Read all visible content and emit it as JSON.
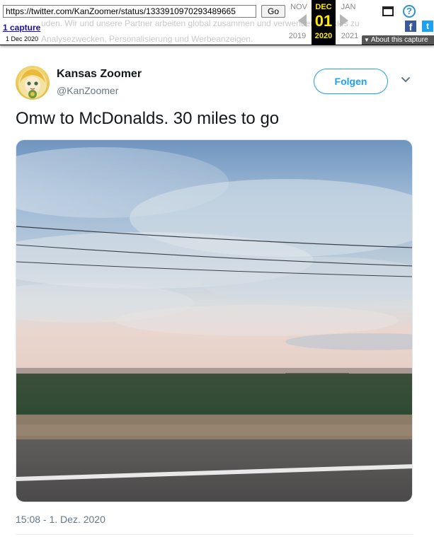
{
  "wayback": {
    "url": "https://twitter.com/KanZoomer/status/1333910970293489665",
    "go_label": "Go",
    "captures_label": "1 capture",
    "capture_date": "1 Dec 2020",
    "prev_month": "NOV",
    "cur_month": "DEC",
    "next_month": "JAN",
    "cur_day": "01",
    "prev_year": "2019",
    "cur_year": "2020",
    "next_year": "2021",
    "about_label": "About this capture",
    "bg_text_line1": "uden. Wir und unsere Partner arbeiten global zusammen und verwenden Cookies zu",
    "bg_text_line2": "Analysezwecken, Personalisierung und Werbeanzeigen.",
    "colors": {
      "current_bg": "#000000",
      "current_text": "#ffea00"
    }
  },
  "tweet": {
    "author_name": "Kansas Zoomer",
    "author_handle": "@KanZoomer",
    "follow_label": "Folgen",
    "text": "Omw to McDonalds. 30 miles to go",
    "timestamp": "15:08 - 1. Dez. 2020",
    "accent_color": "#1da1f2",
    "media_alt": "photo of sky over a flat field seen from a road"
  },
  "icons": [
    "window-icon",
    "help-icon",
    "facebook-icon",
    "twitter-icon",
    "caret-down-icon",
    "avatar-image"
  ]
}
